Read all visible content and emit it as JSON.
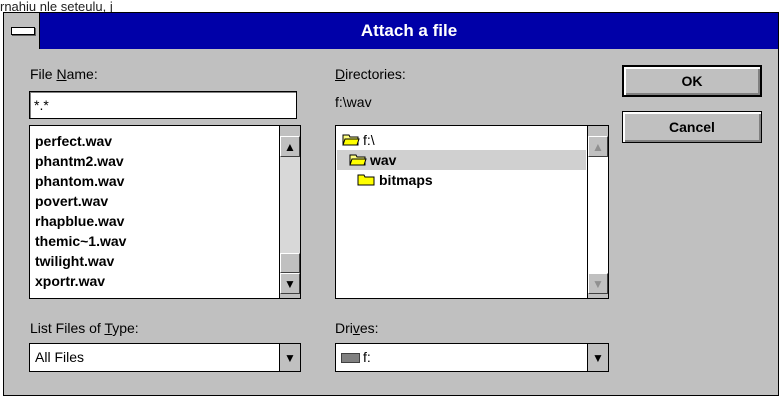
{
  "top_clip": "rnahiu nle seteulu, j",
  "window": {
    "title": "Attach a file"
  },
  "file_name": {
    "label_pre": "File ",
    "label_ul": "N",
    "label_post": "ame:",
    "value": "*.*",
    "files": [
      "perfect.wav",
      "phantm2.wav",
      "phantom.wav",
      "povert.wav",
      "rhapblue.wav",
      "themic~1.wav",
      "twilight.wav",
      "xportr.wav"
    ]
  },
  "directories": {
    "label_ul": "D",
    "label_post": "irectories:",
    "path": "f:\\wav",
    "items": [
      {
        "name": "f:\\",
        "icon": "open-folder-icon"
      },
      {
        "name": "wav",
        "icon": "open-folder-icon"
      },
      {
        "name": "bitmaps",
        "icon": "folder-icon"
      }
    ]
  },
  "file_type": {
    "label_pre": "List Files of ",
    "label_ul": "T",
    "label_post": "ype:",
    "value": "All Files"
  },
  "drives": {
    "label_pre": "Dri",
    "label_ul": "v",
    "label_post": "es:",
    "value": "f:",
    "icon": "drive-icon"
  },
  "buttons": {
    "ok": "OK",
    "cancel": "Cancel"
  },
  "icons": {
    "up": "▲",
    "down": "▼"
  },
  "colors": {
    "titlebar": "#0000a8",
    "face": "#c0c0c0"
  }
}
